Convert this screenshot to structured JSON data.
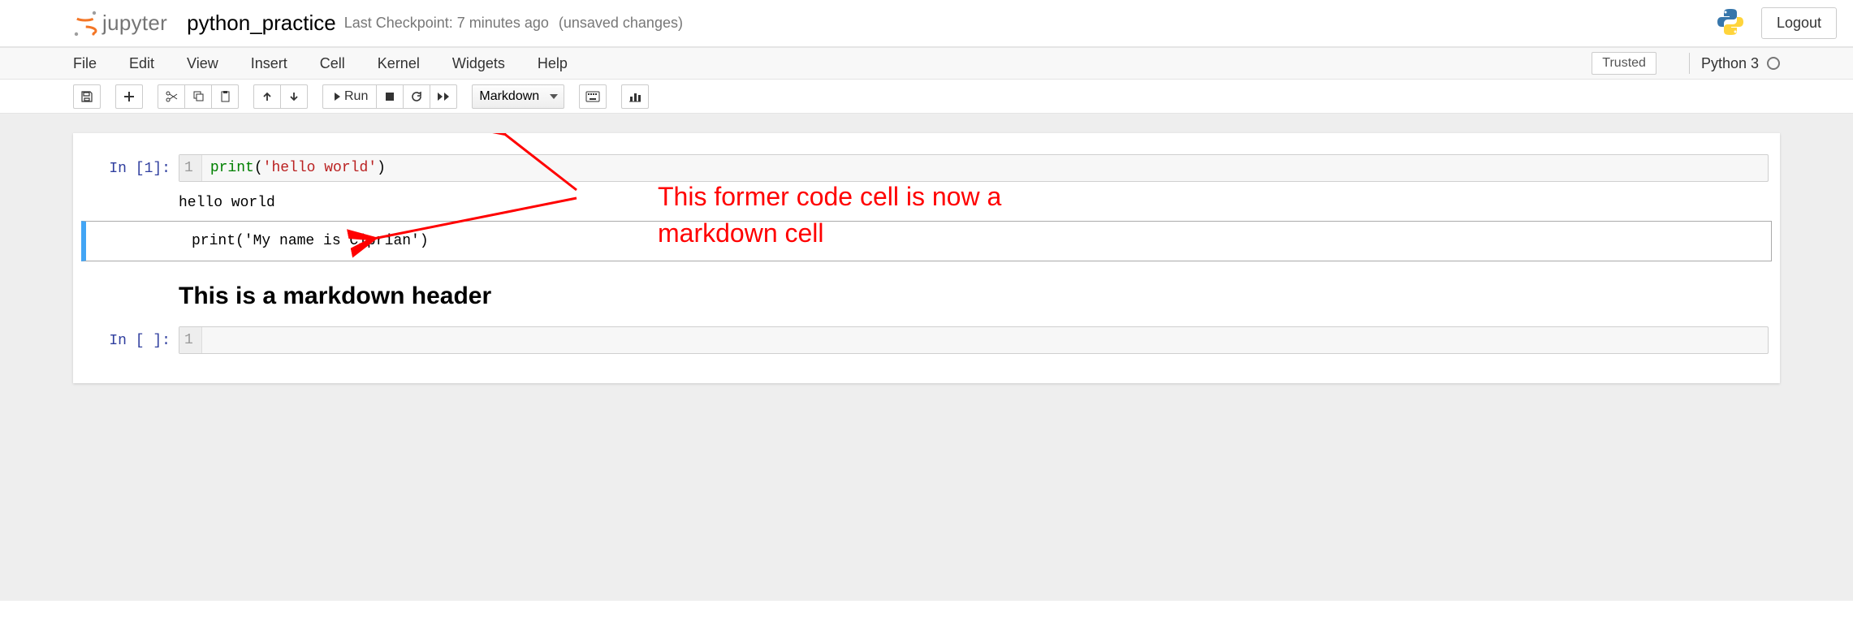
{
  "header": {
    "logo_text": "jupyter",
    "notebook_name": "python_practice",
    "checkpoint": "Last Checkpoint: 7 minutes ago",
    "unsaved": "(unsaved changes)",
    "logout": "Logout"
  },
  "menubar": {
    "items": [
      "File",
      "Edit",
      "View",
      "Insert",
      "Cell",
      "Kernel",
      "Widgets",
      "Help"
    ],
    "trusted": "Trusted",
    "kernel": "Python 3"
  },
  "toolbar": {
    "run_label": "Run",
    "cell_type_selected": "Markdown"
  },
  "cells": {
    "c1": {
      "prompt": "In [1]:",
      "line_no": "1",
      "code_fn": "print",
      "code_paren_open": "(",
      "code_str": "'hello world'",
      "code_paren_close": ")",
      "output": "hello world"
    },
    "c2": {
      "content": "print('My name is Ciprian')"
    },
    "c3": {
      "header": "This is a markdown header"
    },
    "c4": {
      "prompt": "In [ ]:",
      "line_no": "1"
    }
  },
  "annotation": {
    "line1": "This former code cell is now a",
    "line2": "markdown cell"
  }
}
